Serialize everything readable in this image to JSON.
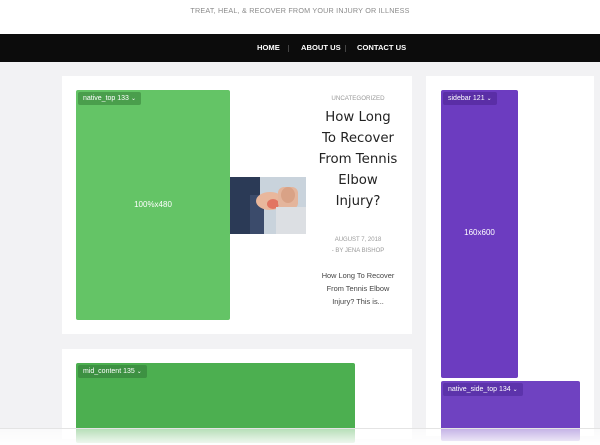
{
  "header": {
    "tagline": "TREAT, HEAL, & RECOVER FROM YOUR INJURY OR ILLNESS"
  },
  "nav": {
    "items": [
      {
        "label": "HOME"
      },
      {
        "label": "ABOUT US"
      },
      {
        "label": "CONTACT US"
      }
    ]
  },
  "post": {
    "category": "UNCATEGORIZED",
    "title": "How Long To Recover From Tennis Elbow Injury?",
    "date": "AUGUST 7, 2018",
    "author": "- BY JENA BISHOP",
    "excerpt": "How Long To Recover From Tennis Elbow Injury? This is..."
  },
  "ads": {
    "native_top": {
      "label": "native_top 133",
      "size": "100%x480",
      "color": "#64c466"
    },
    "sidebar": {
      "label": "sidebar 121",
      "size": "160x600",
      "color": "#6c3cc0"
    },
    "mid_content": {
      "label": "mid_content 135",
      "color": "#4caf50"
    },
    "native_side_top": {
      "label": "native_side_top 134",
      "color": "#6f42c1"
    }
  },
  "icons": {
    "dropdown": "chevron-down-icon"
  }
}
